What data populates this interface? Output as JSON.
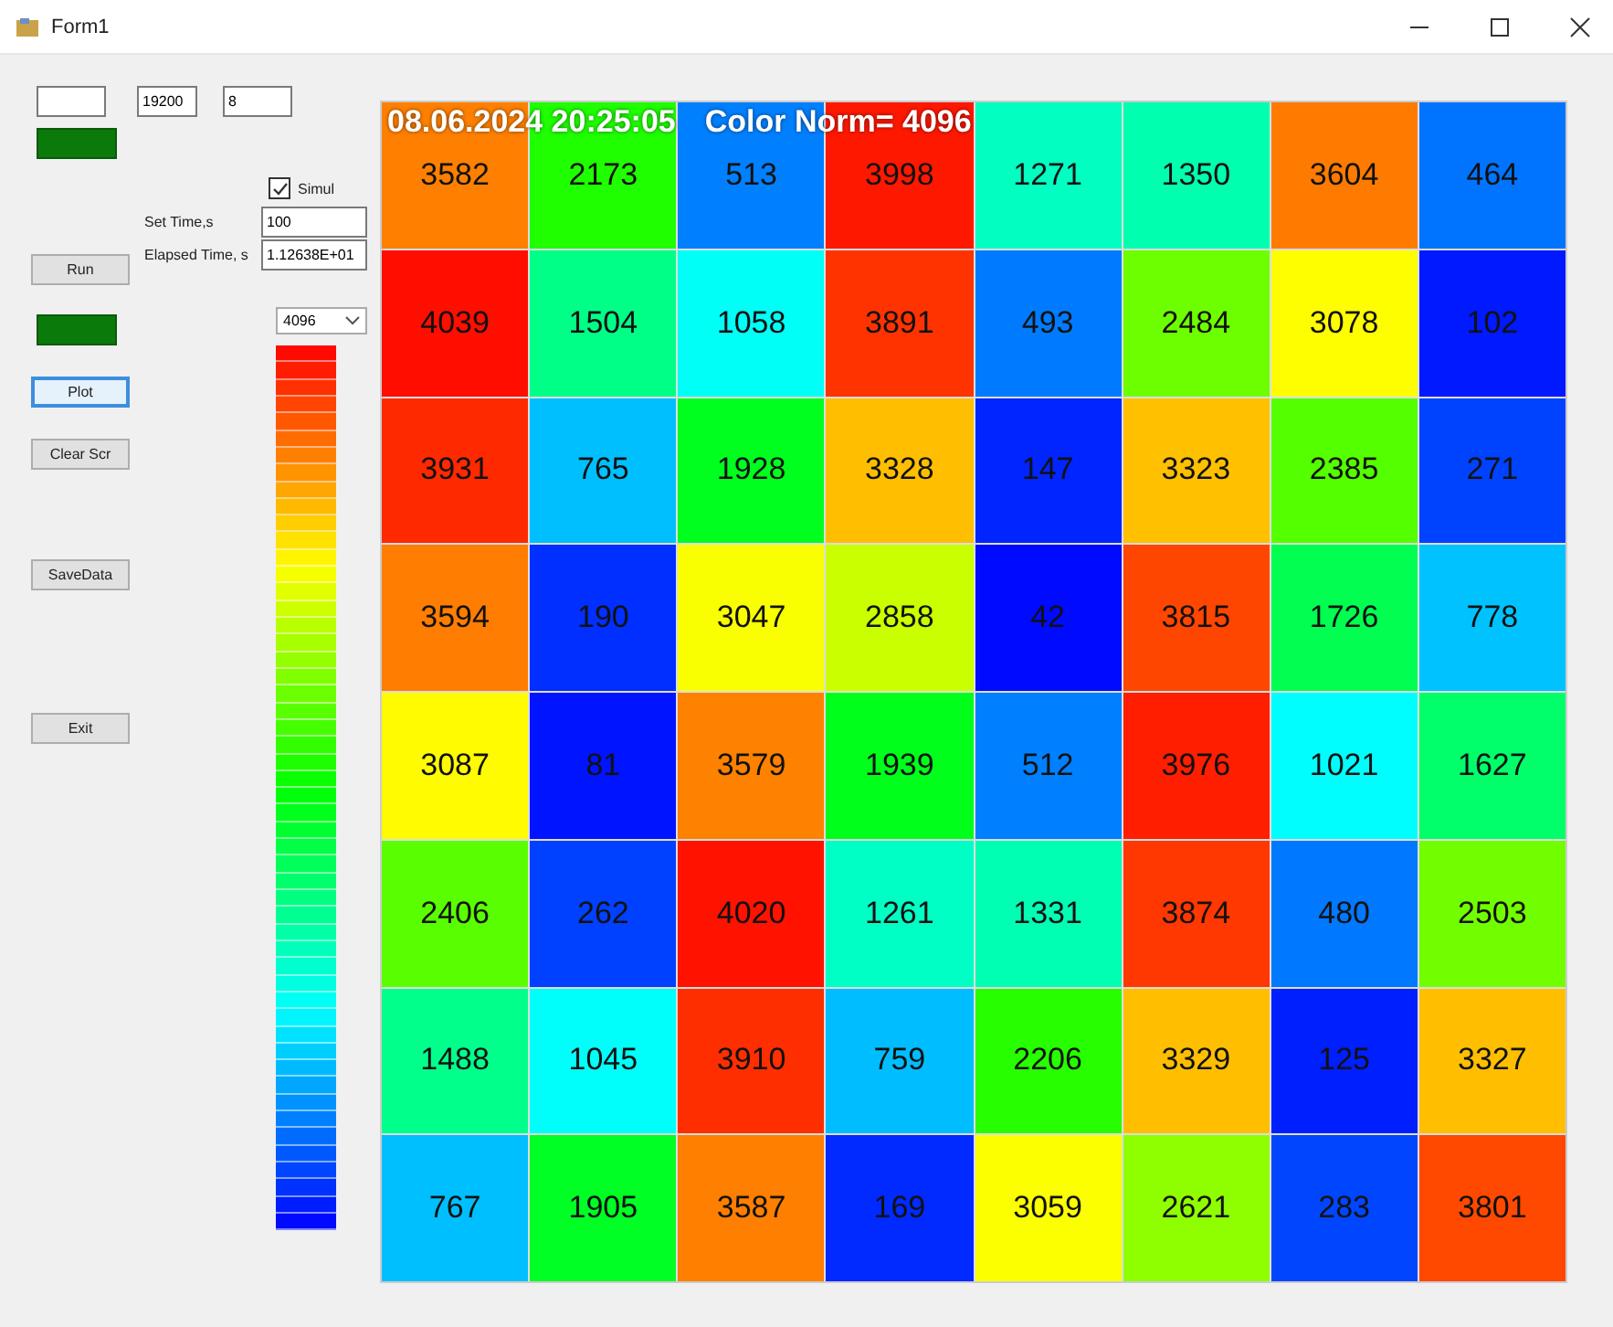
{
  "window": {
    "title": "Form1"
  },
  "top_fields": [
    {
      "kind": "blank"
    },
    {
      "kind": "filled",
      "value": "19200"
    },
    {
      "kind": "filled",
      "value": "8"
    }
  ],
  "buttons": [
    {
      "kind": "indicator"
    },
    {
      "kind": "normal",
      "label": "Run",
      "focused": false
    },
    {
      "kind": "indicator"
    },
    {
      "kind": "normal",
      "label": "Plot",
      "focused": true
    },
    {
      "kind": "normal",
      "label": "Clear Scr",
      "focused": false
    },
    {
      "kind": "normal",
      "label": "SaveData",
      "focused": false
    },
    {
      "kind": "normal",
      "label": "Exit",
      "focused": false
    }
  ],
  "simul": {
    "label": "Simul",
    "checked": true
  },
  "set_time": {
    "label": "Set Time,s",
    "value": "100"
  },
  "elapsed_time": {
    "label": "Elapsed Time, s",
    "value": "1.12638E+01"
  },
  "norm_dropdown": {
    "value": "4096"
  },
  "plot": {
    "timestamp": "08.06.2024 20:25:05",
    "norm_label": "Color Norm= 4096",
    "rows": [
      [
        "3582",
        "2173",
        "513",
        "3998",
        "1271",
        "1350",
        "3604",
        "464"
      ],
      [
        "4039",
        "1504",
        "1058",
        "3891",
        "493",
        "2484",
        "3078",
        "102"
      ],
      [
        "3931",
        "765",
        "1928",
        "3328",
        "147",
        "3323",
        "2385",
        "271"
      ],
      [
        "3594",
        "190",
        "3047",
        "2858",
        "42",
        "3815",
        "1726",
        "778"
      ],
      [
        "3087",
        "81",
        "3579",
        "1939",
        "512",
        "3976",
        "1021",
        "1627"
      ],
      [
        "2406",
        "262",
        "4020",
        "1261",
        "1331",
        "3874",
        "480",
        "2503"
      ],
      [
        "1488",
        "1045",
        "3910",
        "759",
        "2206",
        "3329",
        "125",
        "3327"
      ],
      [
        "767",
        "1905",
        "3587",
        "169",
        "3059",
        "2621",
        "283",
        "3801"
      ]
    ]
  }
}
